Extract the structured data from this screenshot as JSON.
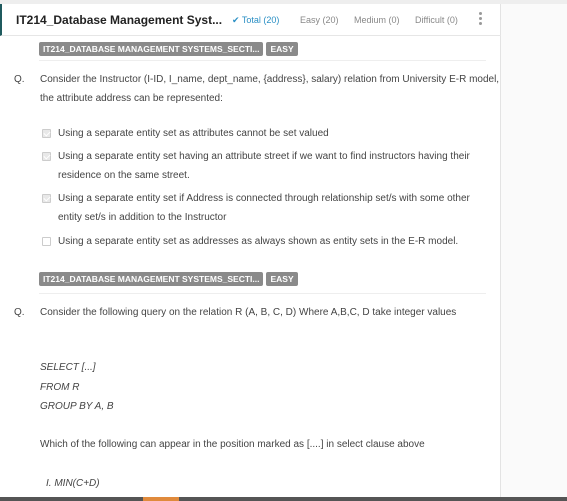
{
  "header": {
    "title": "IT214_Database Management Syst...",
    "filters": [
      {
        "label": "Total (20)",
        "active": true
      },
      {
        "label": "Easy (20)"
      },
      {
        "label": "Medium (0)"
      },
      {
        "label": "Difficult (0)"
      }
    ]
  },
  "questions": [
    {
      "tags": [
        "IT214_DATABASE MANAGEMENT SYSTEMS_SECTI...",
        "EASY"
      ],
      "prefix": "Q.",
      "text": "Consider the  Instructor (I-ID, I_name, dept_name, {address}, salary) relation from University E-R model, the attribute address can be represented:",
      "options": [
        {
          "text": "Using a separate entity set as attributes cannot be set valued",
          "checked": true
        },
        {
          "text": "Using a separate entity set having an attribute street if we want to find instructors having their residence on the same street.",
          "checked": true
        },
        {
          "text": "Using a separate entity set if Address is connected through relationship set/s with some other entity set/s in addition to the Instructor",
          "checked": true
        },
        {
          "text": "Using a separate entity set as addresses as always shown as entity sets in the E-R model.",
          "checked": false
        }
      ]
    },
    {
      "tags": [
        "IT214_DATABASE MANAGEMENT SYSTEMS_SECTI...",
        "EASY"
      ],
      "prefix": "Q.",
      "text": "Consider the following query on the relation R (A, B, C, D) Where A,B,C, D take integer values",
      "code": [
        "SELECT  [...]",
        "FROM  R",
        "GROUP BY A, B"
      ],
      "prompt": "Which of the following can appear in the position marked as [....] in select clause above",
      "items": [
        "I. MIN(C+D)"
      ]
    }
  ]
}
